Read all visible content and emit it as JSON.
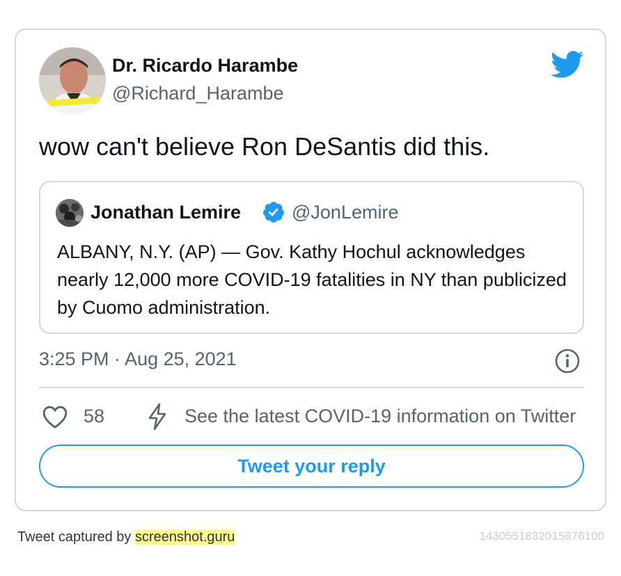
{
  "author": {
    "display_name": "Dr. Ricardo Harambe",
    "handle": "@Richard_Harambe",
    "avatar_icon": "avatar-photo"
  },
  "tweet": {
    "text": "wow can't believe Ron DeSantis did this.",
    "timestamp": "3:25 PM · Aug 25, 2021",
    "like_count": "58",
    "covid_link": "See the latest COVID-19 information on Twitter"
  },
  "quoted": {
    "display_name": "Jonathan Lemire",
    "handle": "@JonLemire",
    "text": "ALBANY, N.Y. (AP) — Gov. Kathy Hochul acknowledges nearly 12,000 more COVID-19 fatalities in NY than publicized by Cuomo administration."
  },
  "actions": {
    "reply_label": "Tweet your reply"
  },
  "footer": {
    "prefix": "Tweet captured by ",
    "brand": "screenshot.guru",
    "tweet_id": "1430551832015876100"
  },
  "colors": {
    "accent": "#1d9bf0",
    "muted": "#536471",
    "border": "#cfd9de",
    "highlight": "#fffb8f"
  },
  "icons": [
    "twitter-bird-icon",
    "verified-badge-icon",
    "info-icon",
    "heart-icon",
    "lightning-bolt-icon"
  ]
}
